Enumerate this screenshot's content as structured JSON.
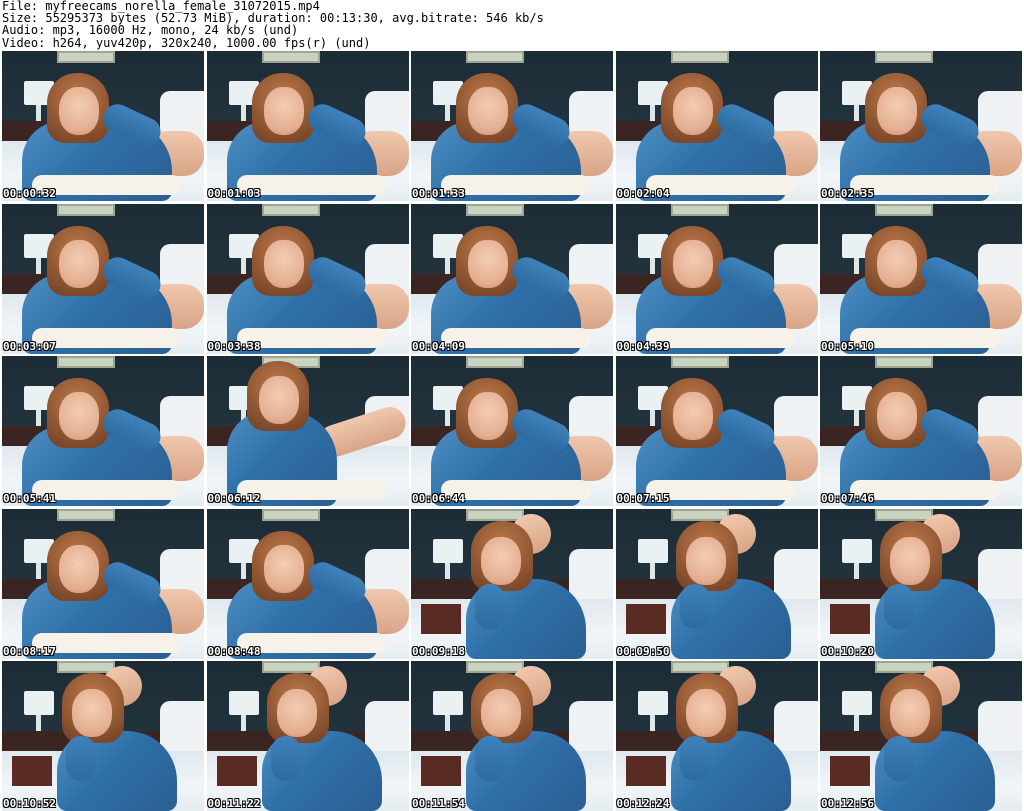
{
  "header": {
    "file": "File: myfreecams_norella_female_31072015.mp4",
    "size": "Size: 55295373 bytes (52.73 MiB), duration: 00:13:30, avg.bitrate: 546 kb/s",
    "audio": "Audio: mp3, 16000 Hz, mono, 24 kb/s (und)",
    "video": "Video: h264, yuv420p, 320x240, 1000.00 fps(r) (und)"
  },
  "thumbnails": [
    {
      "time": "00:00:32",
      "pose": "lying"
    },
    {
      "time": "00:01:03",
      "pose": "lying"
    },
    {
      "time": "00:01:33",
      "pose": "lying"
    },
    {
      "time": "00:02:04",
      "pose": "lying"
    },
    {
      "time": "00:02:35",
      "pose": "lying"
    },
    {
      "time": "00:03:07",
      "pose": "lying"
    },
    {
      "time": "00:03:38",
      "pose": "lying"
    },
    {
      "time": "00:04:09",
      "pose": "lying"
    },
    {
      "time": "00:04:39",
      "pose": "lying"
    },
    {
      "time": "00:05:10",
      "pose": "lying"
    },
    {
      "time": "00:05:41",
      "pose": "lying"
    },
    {
      "time": "00:06:12",
      "pose": "sitting"
    },
    {
      "time": "00:06:44",
      "pose": "lying"
    },
    {
      "time": "00:07:15",
      "pose": "lying"
    },
    {
      "time": "00:07:46",
      "pose": "lying"
    },
    {
      "time": "00:08:17",
      "pose": "lying"
    },
    {
      "time": "00:08:48",
      "pose": "lying"
    },
    {
      "time": "00:09:18",
      "pose": "prone"
    },
    {
      "time": "00:09:50",
      "pose": "prone"
    },
    {
      "time": "00:10:20",
      "pose": "prone"
    },
    {
      "time": "00:10:52",
      "pose": "prone"
    },
    {
      "time": "00:11:22",
      "pose": "prone"
    },
    {
      "time": "00:11:54",
      "pose": "prone"
    },
    {
      "time": "00:12:24",
      "pose": "prone"
    },
    {
      "time": "00:12:56",
      "pose": "prone"
    }
  ],
  "colors": {
    "wall": "#1c2c36",
    "jacket": "#2f6fa8",
    "hair": "#8e5532",
    "bed": "#eef2f4",
    "timestamp_text": "#ffffff"
  }
}
